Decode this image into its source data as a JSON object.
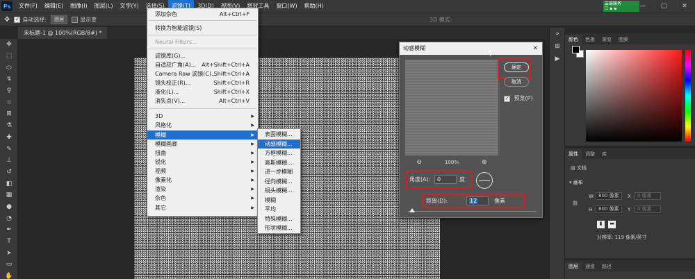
{
  "menubar": {
    "logo": "Ps",
    "items": [
      "文件(F)",
      "编辑(E)",
      "图像(I)",
      "图层(L)",
      "文字(Y)",
      "选择(S)",
      "滤镜(T)",
      "3D(D)",
      "视图(V)",
      "增效工具",
      "窗口(W)",
      "帮助(H)"
    ],
    "active_index": 6,
    "badge_line1": "云端服务",
    "badge_line2": "☐ ▪ ▪",
    "win_min": "—",
    "win_max": "▢",
    "win_close": "✕"
  },
  "options": {
    "move_icon": "✥",
    "auto_select_label": "自动选择:",
    "auto_select_value": "图层",
    "show_transform_label": "显示变",
    "mode_3d_label": "3D 模式:",
    "checkbox_mark": "✓"
  },
  "tab": {
    "title": "未标题-1 @ 100%(RGB/8#) *"
  },
  "filter_menu": {
    "items": [
      {
        "label": "添加杂色",
        "shortcut": "Alt+Ctrl+F"
      },
      {
        "label": "转换为智能滤镜(S)",
        "shortcut": ""
      },
      {
        "label": "Neural Filters...",
        "shortcut": ""
      },
      {
        "label": "滤镜库(G)...",
        "shortcut": ""
      },
      {
        "label": "自适应广角(A)...",
        "shortcut": "Alt+Shift+Ctrl+A"
      },
      {
        "label": "Camera Raw 滤镜(C)...",
        "shortcut": "Shift+Ctrl+A"
      },
      {
        "label": "镜头校正(R)...",
        "shortcut": "Shift+Ctrl+R"
      },
      {
        "label": "液化(L)...",
        "shortcut": "Shift+Ctrl+X"
      },
      {
        "label": "消失点(V)...",
        "shortcut": "Alt+Ctrl+V"
      },
      {
        "label": "3D",
        "shortcut": ""
      },
      {
        "label": "风格化",
        "shortcut": ""
      },
      {
        "label": "模糊",
        "shortcut": ""
      },
      {
        "label": "模糊画廊",
        "shortcut": ""
      },
      {
        "label": "扭曲",
        "shortcut": ""
      },
      {
        "label": "锐化",
        "shortcut": ""
      },
      {
        "label": "视频",
        "shortcut": ""
      },
      {
        "label": "像素化",
        "shortcut": ""
      },
      {
        "label": "渲染",
        "shortcut": ""
      },
      {
        "label": "杂色",
        "shortcut": ""
      },
      {
        "label": "其它",
        "shortcut": ""
      }
    ],
    "submenu_arrow": "▶"
  },
  "blur_submenu": {
    "items": [
      "表面模糊...",
      "动感模糊...",
      "方框模糊...",
      "高斯模糊...",
      "进一步模糊",
      "径向模糊...",
      "镜头模糊...",
      "模糊",
      "平均",
      "特殊模糊...",
      "形状模糊..."
    ],
    "active_index": 1
  },
  "dialog": {
    "title": "动感模糊",
    "close": "✕",
    "ok_label": "确定",
    "cancel_label": "取消",
    "preview_label": "预览(P)",
    "zoom_out": "⊖",
    "zoom_level": "100%",
    "zoom_in": "⊕",
    "angle_label": "角度(A):",
    "angle_value": "0",
    "angle_unit": "度",
    "distance_label": "距离(D):",
    "distance_value": "12",
    "distance_unit": "像素",
    "checkbox_mark": "✓"
  },
  "right_panels": {
    "color_tabs": [
      "颜色",
      "色板",
      "渐变",
      "图案"
    ],
    "props_tabs": [
      "属性",
      "调整",
      "库"
    ],
    "doc_label": "文档",
    "canvas_label": "画布",
    "w_label": "W",
    "w_value": "800 像素",
    "h_label": "H",
    "h_value": "800 像素",
    "x_label": "X",
    "x_value": "0 像素",
    "y_label": "Y",
    "y_value": "0 像素",
    "resolution": "分辨率: 119 像素/英寸",
    "layers_tabs": [
      "图层",
      "通道",
      "路径"
    ]
  },
  "colors": {
    "accent": "#1e6fcf",
    "highlight_box": "#d0202a"
  }
}
